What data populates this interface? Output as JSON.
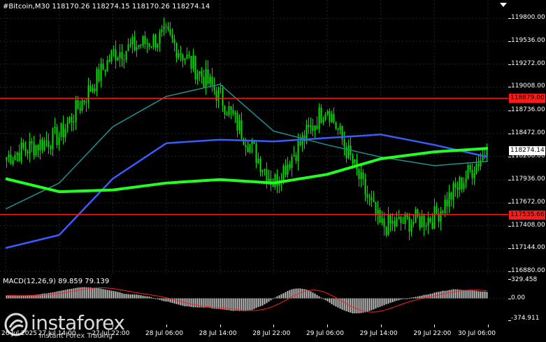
{
  "header": {
    "symbol": "#Bitcoin,M30",
    "ohlc": "118170.26 118274.15 118170.26 118274.14"
  },
  "macd_header": {
    "label": "MACD(12,26,9) 89.859 79.139"
  },
  "price_axis": {
    "labels": [
      "119800.00",
      "119536.00",
      "119272.00",
      "119008.00",
      "118736.00",
      "118472.00",
      "118208.00",
      "117936.00",
      "117672.00",
      "117408.00",
      "117144.00",
      "116880.00"
    ],
    "current_price": "118274.14",
    "resistance_price": "118879.00",
    "support_price": "117535.66"
  },
  "macd_axis": {
    "labels": [
      "329.458",
      "0.00",
      "-374.911"
    ]
  },
  "time_axis": {
    "labels": [
      "26 Jul 2025",
      "27 Jul 14:00",
      "27 Jul 22:00",
      "28 Jul 06:00",
      "28 Jul 14:00",
      "28 Jul 22:00",
      "29 Jul 06:00",
      "29 Jul 14:00",
      "29 Jul 22:00",
      "30 Jul 06:00"
    ]
  },
  "watermark": {
    "brand": "instaforex",
    "tagline": "Instant Forex Trading",
    "logo_icon": "instaforex-logo-icon"
  },
  "colors": {
    "bull": "#00e000",
    "ma_fast": "#1f8f8f",
    "ma_mid": "#3a5cff",
    "ma_slow": "#22ff22",
    "level": "#ff1a1a",
    "grid": "#1a2a1a",
    "macd_signal": "#ff2020",
    "macd_hist": "#c0c0c0",
    "current_bg": "#ffffff",
    "level_bg": "#ff1a1a"
  },
  "chart_data": {
    "type": "line",
    "symbol": "#Bitcoin",
    "timeframe": "M30",
    "ylim": [
      116880,
      119900
    ],
    "x": [
      "26 Jul 2025",
      "27 Jul 14:00",
      "27 Jul 22:00",
      "28 Jul 06:00",
      "28 Jul 14:00",
      "28 Jul 22:00",
      "29 Jul 06:00",
      "29 Jul 14:00",
      "29 Jul 22:00",
      "30 Jul 06:00"
    ],
    "series": [
      {
        "values": [
          118200,
          118450,
          119400,
          119600,
          118900,
          117900,
          118800,
          117400,
          117500,
          118280
        ]
      },
      {
        "values": [
          117600,
          117900,
          118550,
          118900,
          119040,
          118500,
          118340,
          118200,
          118100,
          118150
        ]
      },
      {
        "values": [
          117150,
          117300,
          117950,
          118360,
          118400,
          118380,
          118420,
          118460,
          118340,
          118200
        ]
      },
      {
        "values": [
          117950,
          117800,
          117820,
          117900,
          117940,
          117900,
          118000,
          118180,
          118260,
          118300
        ]
      }
    ],
    "levels": [
      118879.0,
      117535.66
    ],
    "macd": {
      "params": "12,26,9",
      "ylim": [
        -374.911,
        329.458
      ],
      "histogram_range": [
        -374.911,
        329.458
      ]
    }
  }
}
